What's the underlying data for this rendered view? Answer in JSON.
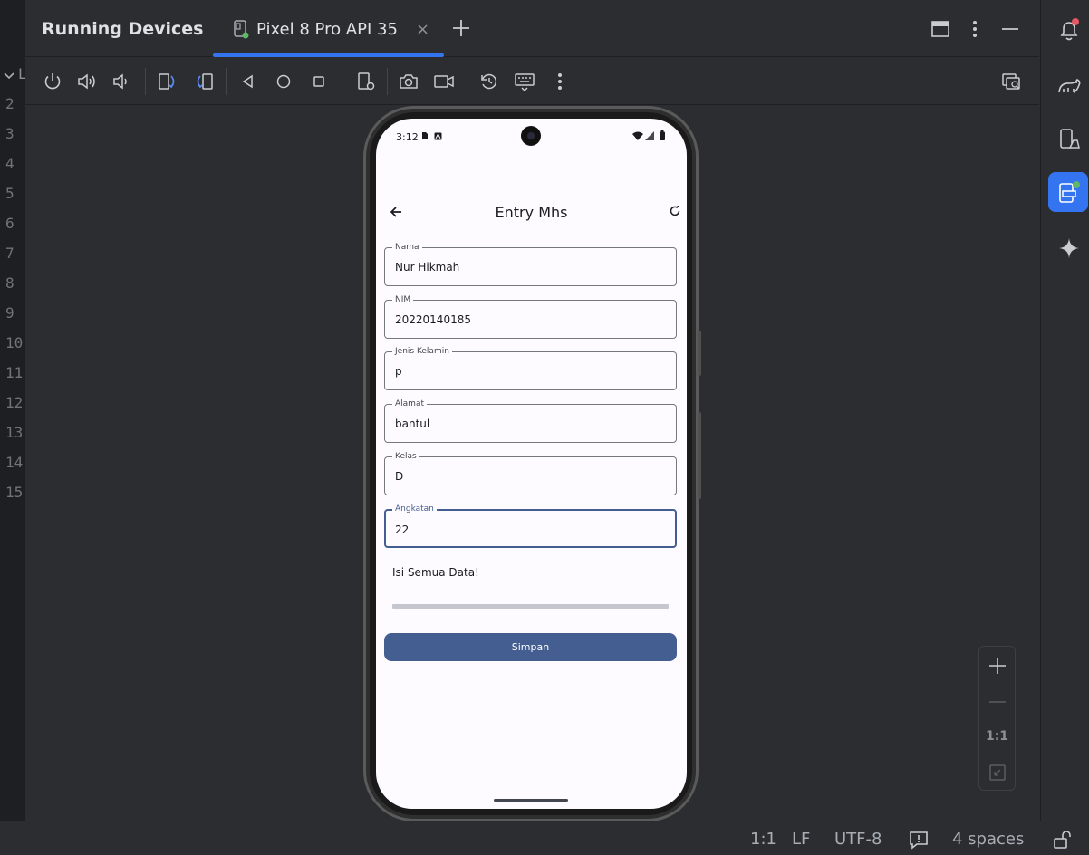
{
  "gutter": {
    "lines": [
      "L",
      "2",
      "3",
      "4",
      "5",
      "6",
      "7",
      "8",
      "9",
      "10",
      "11",
      "12",
      "13",
      "14",
      "15"
    ]
  },
  "header": {
    "title": "Running Devices",
    "tab_label": "Pixel 8 Pro API 35",
    "tab_close": "×"
  },
  "toolbar": {
    "buttons": [
      "power-icon",
      "volume-up-icon",
      "volume-down-icon",
      "rotate-left-icon",
      "rotate-right-icon",
      "back-icon",
      "home-icon",
      "overview-icon",
      "device-settings-icon",
      "screenshot-icon",
      "screen-record-icon",
      "snapshot-icon",
      "keyboard-icon",
      "more-icon",
      "device-mirror-icon"
    ]
  },
  "phone": {
    "status_time": "3:12",
    "app_title": "Entry Mhs",
    "fields": [
      {
        "label": "Nama",
        "value": "Nur Hikmah"
      },
      {
        "label": "NIM",
        "value": "20220140185"
      },
      {
        "label": "Jenis Kelamin",
        "value": "p"
      },
      {
        "label": "Alamat",
        "value": "bantul"
      },
      {
        "label": "Kelas",
        "value": "D"
      },
      {
        "label": "Angkatan",
        "value": "22"
      }
    ],
    "message": "Isi Semua Data!",
    "save_label": "Simpan"
  },
  "zoom": {
    "one_to_one": "1:1"
  },
  "statusbar": {
    "position": "1:1",
    "line_sep": "LF",
    "encoding": "UTF-8",
    "indent": "4 spaces"
  },
  "colors": {
    "accent": "#3574f0",
    "primary": "#445e91",
    "notification_dot": "#e55765",
    "running_dot": "#5fb865"
  }
}
